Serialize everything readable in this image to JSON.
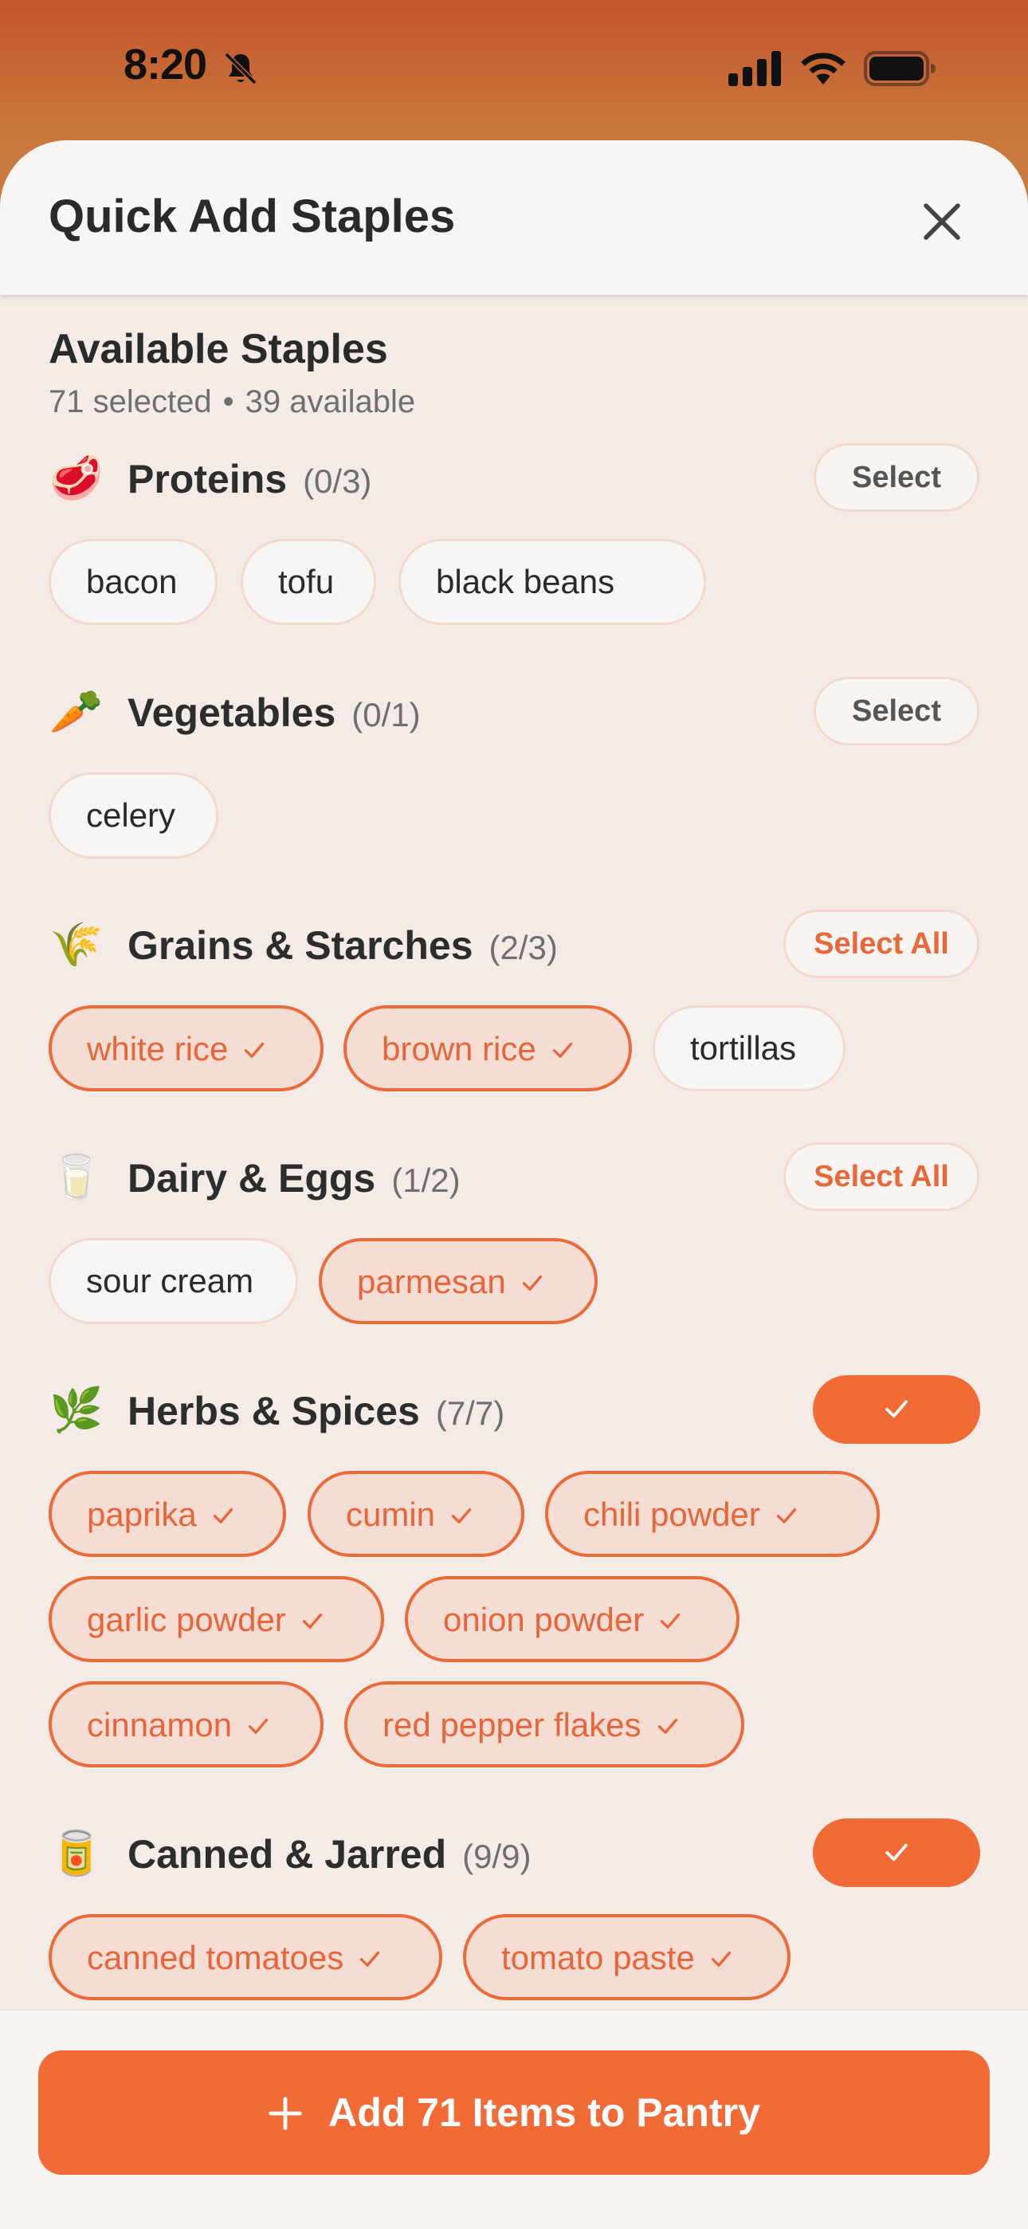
{
  "status": {
    "time": "8:20"
  },
  "sheet": {
    "title": "Quick Add Staples"
  },
  "summary": {
    "title": "Available Staples",
    "selected": "71 selected",
    "available": "39 available"
  },
  "sections": [
    {
      "emoji": "🥩",
      "name": "Proteins",
      "count": "(0/3)",
      "button": "Select",
      "items": [
        {
          "label": "bacon",
          "selected": false
        },
        {
          "label": "tofu",
          "selected": false
        },
        {
          "label": "black beans",
          "selected": false
        }
      ]
    },
    {
      "emoji": "🥕",
      "name": "Vegetables",
      "count": "(0/1)",
      "button": "Select",
      "items": [
        {
          "label": "celery",
          "selected": false
        }
      ]
    },
    {
      "emoji": "🌾",
      "name": "Grains & Starches",
      "count": "(2/3)",
      "button": "Select All",
      "items": [
        {
          "label": "white rice",
          "selected": true
        },
        {
          "label": "brown rice",
          "selected": true
        },
        {
          "label": "tortillas",
          "selected": false
        }
      ]
    },
    {
      "emoji": "🥛",
      "name": "Dairy & Eggs",
      "count": "(1/2)",
      "button": "Select All",
      "items": [
        {
          "label": "sour cream",
          "selected": false
        },
        {
          "label": "parmesan",
          "selected": true
        }
      ]
    },
    {
      "emoji": "🌿",
      "name": "Herbs & Spices",
      "count": "(7/7)",
      "button": "",
      "items": [
        {
          "label": "paprika",
          "selected": true
        },
        {
          "label": "cumin",
          "selected": true
        },
        {
          "label": "chili powder",
          "selected": true
        },
        {
          "label": "garlic powder",
          "selected": true
        },
        {
          "label": "onion powder",
          "selected": true
        },
        {
          "label": "cinnamon",
          "selected": true
        },
        {
          "label": "red pepper flakes",
          "selected": true
        }
      ]
    },
    {
      "emoji": "🥫",
      "name": "Canned & Jarred",
      "count": "(9/9)",
      "button": "",
      "items": [
        {
          "label": "canned tomatoes",
          "selected": true
        },
        {
          "label": "tomato paste",
          "selected": true
        }
      ]
    }
  ],
  "footer": {
    "add_label": "Add 71 Items to Pantry"
  },
  "colors": {
    "accent": "#f26a36",
    "chip_selected_bg": "#f5ddd4",
    "sheet_bg": "#f5ebe6"
  }
}
